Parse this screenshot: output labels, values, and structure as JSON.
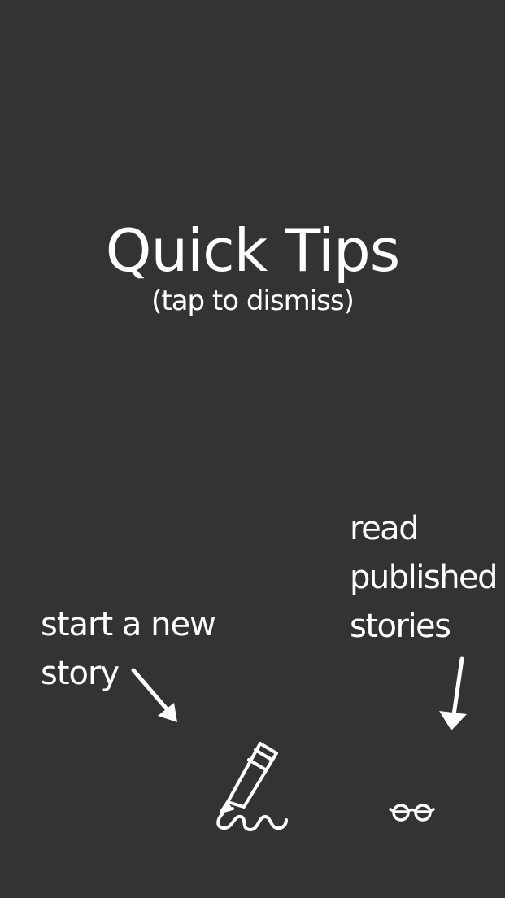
{
  "overlay": {
    "title": "Quick Tips",
    "subtitle": "(tap to dismiss)"
  },
  "tips": {
    "new_story": {
      "line1": "start a new",
      "line2": "story"
    },
    "read_published": {
      "line1": "read",
      "line2": "published",
      "line3": "stories"
    }
  },
  "icons": {
    "write": "pencil-icon",
    "read": "glasses-icon",
    "arrow_left": "arrow-down-right-icon",
    "arrow_right": "arrow-down-icon"
  },
  "colors": {
    "background": "#333333",
    "text": "#ffffff"
  }
}
